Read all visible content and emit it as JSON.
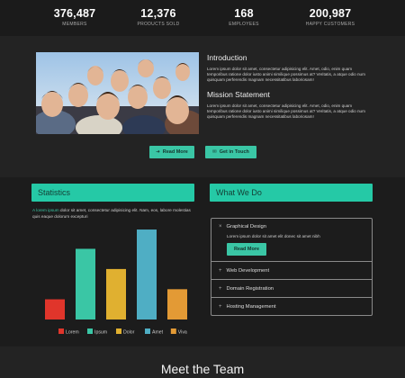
{
  "stats": [
    {
      "value": "376,487",
      "label": "MEMBERS"
    },
    {
      "value": "12,376",
      "label": "PRODUCTS SOLD"
    },
    {
      "value": "168",
      "label": "EMPLOYEES"
    },
    {
      "value": "200,987",
      "label": "HAPPY CUSTOMERS"
    }
  ],
  "about": {
    "intro_title": "Introduction",
    "intro_text": "Lorem ipsum dolor sit amet, consectetur adipisicing elit. Amet, odio, enim quam temporibus ratione dolor iusto animi similique possimus at? Veritatis, a atque odio num quisquam perferendis magnam necessitatibus laboriosam!",
    "mission_title": "Mission Statement",
    "mission_text": "Lorem ipsum dolor sit amet, consectetur adipisicing elit. Amet, odio, enim quam temporibus ratione dolor iusto animi similique possimus at? Veritatis, a atque odio num quisquam perferendis magnam necessitatibus laboriosam!",
    "read_more_label": "Read More",
    "get_in_touch_label": "Get in Touch"
  },
  "statistics": {
    "title": "Statistics",
    "intro_highlight": "A lorem ipsum",
    "intro_text": " dolor sit amet, consectetur adipisicing elit. Nam, eos, labore molestias quis eaque dolorum excepturi"
  },
  "chart_data": {
    "type": "bar",
    "categories": [
      "Lorem",
      "Ipsum",
      "Dolor",
      "Amet",
      "Viva"
    ],
    "values": [
      22,
      77,
      55,
      98,
      33
    ],
    "colors": [
      "#e0352b",
      "#3ac6a5",
      "#e0b030",
      "#4faec4",
      "#e39a35"
    ],
    "legend_position": "bottom",
    "ylim": [
      0,
      100
    ]
  },
  "what_we_do": {
    "title": "What We Do",
    "items": [
      {
        "label": "Graphical Design",
        "body": "Lorem ipsum dolor sit amet elit donec sit amet nibh",
        "button": "Read More"
      },
      {
        "label": "Web Development"
      },
      {
        "label": "Domain Registration"
      },
      {
        "label": "Hosting Management"
      }
    ]
  },
  "team": {
    "title": "Meet the Team"
  }
}
